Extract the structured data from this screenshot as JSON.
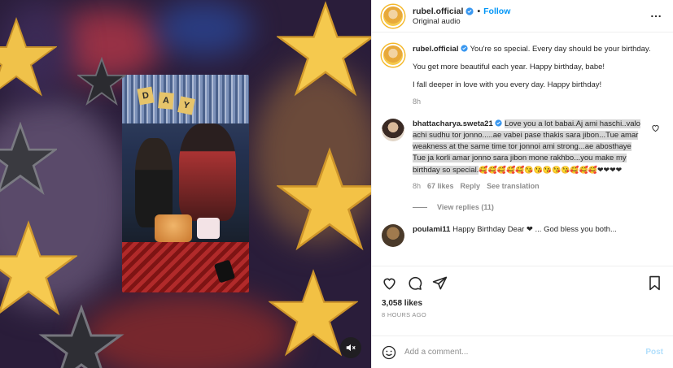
{
  "header": {
    "username": "rubel.official",
    "separator": "•",
    "follow_label": "Follow",
    "audio": "Original audio"
  },
  "caption": {
    "username": "rubel.official",
    "para1": "You're so special. Every day should be your birthday.",
    "para2": "You get more beautiful each year. Happy birthday, babe!",
    "para3": "I fall deeper in love with you every day. Happy birthday!",
    "time": "8h"
  },
  "comment1": {
    "username": "bhattacharya.sweta21",
    "text": "Love you a lot babai.Aj ami haschi..valo achi sudhu tor jonno.....ae vabei pase thakis sara jibon...Tue amar weakness at the same time tor jonnoi ami strong...ae abosthaye Tue ja korli amar jonno sara jibon mone rakhbo...you make my birthday so special.",
    "emojis": "🥰🥰🥰🥰🥰😘😘😘😘😘🥰🥰🥰❤❤❤❤",
    "time": "8h",
    "likes": "67 likes",
    "reply": "Reply",
    "see_translation": "See translation",
    "view_replies": "View replies (11)"
  },
  "comment2": {
    "username": "poulami11",
    "text": "Happy Birthday Dear ❤ ... God bless you both..."
  },
  "post": {
    "likes": "3,058 likes",
    "time": "8 HOURS AGO"
  },
  "add_comment": {
    "placeholder": "Add a comment...",
    "post_label": "Post"
  },
  "media": {
    "banner_letters": [
      "D",
      "A",
      "Y"
    ]
  },
  "colors": {
    "accent": "#0095f6",
    "verified": "#3897f0",
    "heart": "#ed4956",
    "post_disabled": "#b2dffc"
  }
}
